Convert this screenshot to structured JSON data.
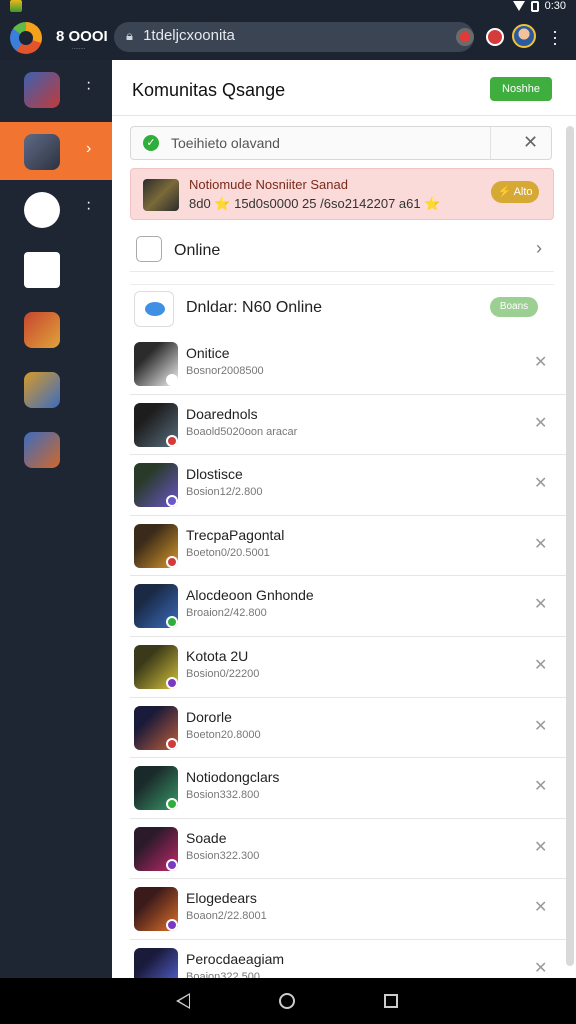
{
  "status_bar": {
    "time": "0:30",
    "icons": [
      "wifi-icon",
      "battery-icon"
    ]
  },
  "app_bar": {
    "app_name": "8 OOOI",
    "app_sub": "........",
    "url": "1tdeljcxoonita",
    "icons": [
      "logo-icon",
      "lock-icon",
      "record-icon",
      "notification-icon",
      "avatar",
      "more-icon"
    ]
  },
  "sidebar": {
    "items": [
      {
        "name": "game-1",
        "colors": [
          "#3a62b0",
          "#c23a3a"
        ]
      },
      {
        "name": "game-2",
        "colors": [
          "#5e6a86",
          "#2d3240"
        ]
      },
      {
        "name": "controller",
        "colors": [
          "#ffffff",
          "#ffffff"
        ]
      },
      {
        "name": "dice",
        "colors": [
          "#ffffff",
          "#222222"
        ]
      },
      {
        "name": "game-5",
        "colors": [
          "#c7452f",
          "#e0a33a"
        ]
      },
      {
        "name": "game-6",
        "colors": [
          "#d79a2a",
          "#3b6cc0"
        ]
      },
      {
        "name": "game-7",
        "colors": [
          "#3b6cc0",
          "#d0682a"
        ]
      }
    ]
  },
  "main": {
    "title": "Komunitas Qsange",
    "header_button": "Noshhe",
    "search": {
      "value": "Toeihieto olavand",
      "check": "✓",
      "close": "✕"
    },
    "promo": {
      "title": "Notiomude Nosniiter Sanad",
      "subtitle": "8d0 ⭐ 15d0s0000 25 /6so2142207 a61 ⭐",
      "button": "⚡ Alto"
    },
    "online_row": {
      "label": "Online",
      "chevron": "›"
    },
    "section": {
      "label": "Dnldar: N60 Online",
      "badge": "Boans"
    },
    "games": [
      {
        "name": "Onitice",
        "meta": "Bosnor2008500",
        "colors": [
          "#2b2b2b",
          "#f4f4f4"
        ],
        "badge": "#ffffff"
      },
      {
        "name": "Doarednols",
        "meta": "Boaold5020oon aracar",
        "colors": [
          "#1d1d1d",
          "#5a6f7f"
        ],
        "badge": "#d33a3a"
      },
      {
        "name": "Dlostisce",
        "meta": "Bosion12/2.800",
        "colors": [
          "#2a3a2a",
          "#6a58c8"
        ],
        "badge": "#6a58c8"
      },
      {
        "name": "TrecpaPagontal",
        "meta": "Boeton0/20.5001",
        "colors": [
          "#3a2a1a",
          "#d89a2a"
        ],
        "badge": "#d33a3a"
      },
      {
        "name": "Alocdeoon Gnhonde",
        "meta": "Broaion2/42.800",
        "colors": [
          "#1a2a44",
          "#3b6cc0"
        ],
        "badge": "#2fae3b"
      },
      {
        "name": "Kotota 2U",
        "meta": "Bosion0/22200",
        "colors": [
          "#3a3a1a",
          "#d8c23a"
        ],
        "badge": "#7a3ac0"
      },
      {
        "name": "Dororle",
        "meta": "Boeton20.8000",
        "colors": [
          "#1a1a3a",
          "#c0603a"
        ],
        "badge": "#d33a3a"
      },
      {
        "name": "Notiodongclars",
        "meta": "Bosion332.800",
        "colors": [
          "#1a2a2a",
          "#3a9a6a"
        ],
        "badge": "#2fae3b"
      },
      {
        "name": "Soade",
        "meta": "Bosion322.300",
        "colors": [
          "#2a1a2a",
          "#c02a6a"
        ],
        "badge": "#7a3ac0"
      },
      {
        "name": "Elogedears",
        "meta": "Boaon2/22.8001",
        "colors": [
          "#3a1a1a",
          "#e0702a"
        ],
        "badge": "#7a3ac0"
      },
      {
        "name": "Perocdaeagiam",
        "meta": "Boaion322.500",
        "colors": [
          "#1a1a3a",
          "#5a6ae0"
        ],
        "badge": "#3b6cc0"
      }
    ]
  },
  "nav_bar": {
    "icons": [
      "back-icon",
      "home-icon",
      "recents-icon"
    ]
  }
}
